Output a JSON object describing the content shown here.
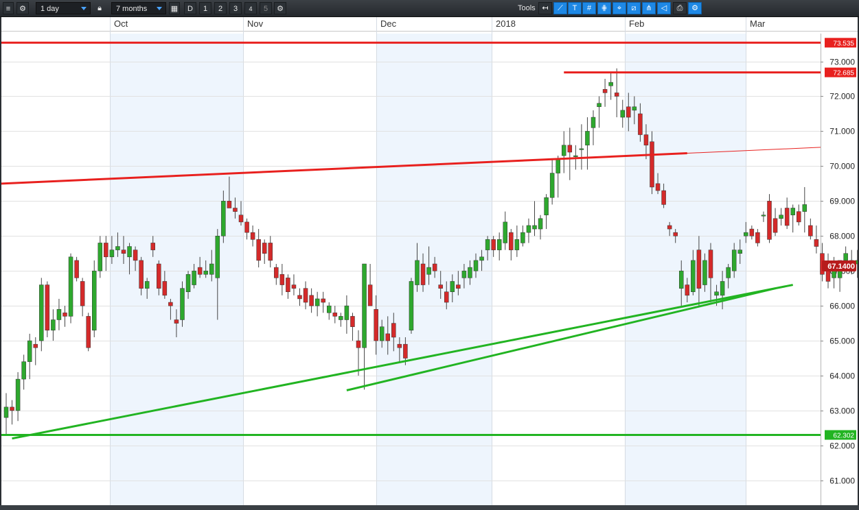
{
  "toolbar": {
    "interval": "1 day",
    "period": "7 months",
    "quick_d": "D",
    "quick_1": "1",
    "quick_2": "2",
    "quick_3": "3",
    "quick_4": "4",
    "quick_5": "5",
    "tools_label": "Tools"
  },
  "colors": {
    "up": "#2ea82e",
    "down": "#d42a2a",
    "trend_red": "#e8201e",
    "trend_green": "#22b422",
    "price_badge": "#b71c1c",
    "band": "#eef5fd"
  },
  "chart_data": {
    "type": "candlestick",
    "ylim": [
      60.8,
      73.6
    ],
    "y_ticks": [
      "73.000",
      "72.000",
      "71.000",
      "70.000",
      "69.000",
      "68.000",
      "67.000",
      "66.000",
      "65.000",
      "64.000",
      "63.000",
      "62.000",
      "61.000"
    ],
    "x_labels": [
      "Oct",
      "Nov",
      "Dec",
      "2018",
      "Feb",
      "Mar"
    ],
    "horizontal_levels": [
      {
        "value": 73.535,
        "label": "73.535",
        "color": "red"
      },
      {
        "value": 62.302,
        "label": "62.302",
        "color": "green"
      }
    ],
    "segment_levels": [
      {
        "value": 72.685,
        "label": "72.685",
        "color": "red",
        "from_index": 95
      }
    ],
    "last_price": {
      "value": 67.14,
      "label": "67.1400"
    },
    "trendlines": [
      {
        "color": "red",
        "points": [
          [
            0,
            69.5
          ],
          [
            116,
            70.37
          ]
        ],
        "extend_to": 134
      },
      {
        "color": "green",
        "points": [
          [
            1,
            62.2
          ],
          [
            134,
            66.6
          ]
        ]
      },
      {
        "color": "green",
        "points": [
          [
            58,
            63.58
          ],
          [
            131,
            66.5
          ]
        ]
      }
    ],
    "candles": [
      [
        62.8,
        63.5,
        62.3,
        63.1
      ],
      [
        63.1,
        63.3,
        62.6,
        63.0
      ],
      [
        63.0,
        64.1,
        62.7,
        63.9
      ],
      [
        63.9,
        64.6,
        63.6,
        64.4
      ],
      [
        64.4,
        65.2,
        63.9,
        65.0
      ],
      [
        64.9,
        65.1,
        64.3,
        64.8
      ],
      [
        65.0,
        66.8,
        64.7,
        66.6
      ],
      [
        66.6,
        66.7,
        65.1,
        65.3
      ],
      [
        65.3,
        65.9,
        65.0,
        65.6
      ],
      [
        65.6,
        66.2,
        65.3,
        65.9
      ],
      [
        65.8,
        66.0,
        65.4,
        65.7
      ],
      [
        65.7,
        67.5,
        65.5,
        67.4
      ],
      [
        67.3,
        67.4,
        66.7,
        66.8
      ],
      [
        66.7,
        66.8,
        65.7,
        66.0
      ],
      [
        65.7,
        65.8,
        64.7,
        64.8
      ],
      [
        65.3,
        67.3,
        65.1,
        67.0
      ],
      [
        67.0,
        68.0,
        66.8,
        67.8
      ],
      [
        67.8,
        68.0,
        67.0,
        67.4
      ],
      [
        67.4,
        68.0,
        67.2,
        67.6
      ],
      [
        67.6,
        68.1,
        67.4,
        67.7
      ],
      [
        67.6,
        68.0,
        67.2,
        67.5
      ],
      [
        67.4,
        67.8,
        66.9,
        67.7
      ],
      [
        67.6,
        67.7,
        67.0,
        67.3
      ],
      [
        67.3,
        67.4,
        66.3,
        66.5
      ],
      [
        66.5,
        66.8,
        66.2,
        66.7
      ],
      [
        67.8,
        68.0,
        67.4,
        67.6
      ],
      [
        67.2,
        67.3,
        66.3,
        66.5
      ],
      [
        66.7,
        67.0,
        66.2,
        66.3
      ],
      [
        66.1,
        66.2,
        65.6,
        66.0
      ],
      [
        65.6,
        65.9,
        65.1,
        65.5
      ],
      [
        65.6,
        66.7,
        65.4,
        66.5
      ],
      [
        66.4,
        67.0,
        66.2,
        66.9
      ],
      [
        66.6,
        67.2,
        66.5,
        67.0
      ],
      [
        67.1,
        67.4,
        66.8,
        66.9
      ],
      [
        66.9,
        67.3,
        66.8,
        67.0
      ],
      [
        66.9,
        67.6,
        66.7,
        67.2
      ],
      [
        66.8,
        68.2,
        65.6,
        68.0
      ],
      [
        68.0,
        69.3,
        67.8,
        69.0
      ],
      [
        69.0,
        69.7,
        68.9,
        68.8
      ],
      [
        68.8,
        69.1,
        68.5,
        68.7
      ],
      [
        68.6,
        69.0,
        68.3,
        68.4
      ],
      [
        68.4,
        68.5,
        67.9,
        68.1
      ],
      [
        68.1,
        68.3,
        67.7,
        67.9
      ],
      [
        67.9,
        68.2,
        67.1,
        67.3
      ],
      [
        67.8,
        67.9,
        67.2,
        67.5
      ],
      [
        67.8,
        68.0,
        67.1,
        67.3
      ],
      [
        67.1,
        67.2,
        66.6,
        66.8
      ],
      [
        66.9,
        67.2,
        66.3,
        66.6
      ],
      [
        66.8,
        66.9,
        66.2,
        66.4
      ],
      [
        66.6,
        66.9,
        66.3,
        66.5
      ],
      [
        66.3,
        66.5,
        66.0,
        66.2
      ],
      [
        66.5,
        66.7,
        65.9,
        66.1
      ],
      [
        66.3,
        66.5,
        65.8,
        66.0
      ],
      [
        66.0,
        66.4,
        65.7,
        66.2
      ],
      [
        66.2,
        66.4,
        65.8,
        66.1
      ],
      [
        65.8,
        66.1,
        65.6,
        66.0
      ],
      [
        65.8,
        66.0,
        65.5,
        65.7
      ],
      [
        65.6,
        65.8,
        65.4,
        65.7
      ],
      [
        65.6,
        66.3,
        65.2,
        66.0
      ],
      [
        65.7,
        65.8,
        65.0,
        65.4
      ],
      [
        65.0,
        65.3,
        64.0,
        64.8
      ],
      [
        64.8,
        66.9,
        63.6,
        67.2
      ],
      [
        66.6,
        67.2,
        66.0,
        66.0
      ],
      [
        65.9,
        66.3,
        64.6,
        65.0
      ],
      [
        65.0,
        65.6,
        64.8,
        65.4
      ],
      [
        65.2,
        65.7,
        64.6,
        65.0
      ],
      [
        65.5,
        65.8,
        64.7,
        65.1
      ],
      [
        64.9,
        65.1,
        64.4,
        64.8
      ],
      [
        64.9,
        65.1,
        64.3,
        64.5
      ],
      [
        65.3,
        66.8,
        65.2,
        66.7
      ],
      [
        66.6,
        67.8,
        66.4,
        67.3
      ],
      [
        67.2,
        67.5,
        66.4,
        66.6
      ],
      [
        66.9,
        67.7,
        66.6,
        67.1
      ],
      [
        67.2,
        67.4,
        66.8,
        67.0
      ],
      [
        66.6,
        67.0,
        66.2,
        66.5
      ],
      [
        66.4,
        66.7,
        65.9,
        66.1
      ],
      [
        66.4,
        66.9,
        66.1,
        66.7
      ],
      [
        66.6,
        67.0,
        66.3,
        66.5
      ],
      [
        66.8,
        67.2,
        66.5,
        67.0
      ],
      [
        66.8,
        67.3,
        66.6,
        67.1
      ],
      [
        67.0,
        67.5,
        66.8,
        67.3
      ],
      [
        67.3,
        67.6,
        67.0,
        67.4
      ],
      [
        67.6,
        68.0,
        67.3,
        67.9
      ],
      [
        67.9,
        68.0,
        67.4,
        67.6
      ],
      [
        67.6,
        68.1,
        67.3,
        67.9
      ],
      [
        67.8,
        68.7,
        67.6,
        68.4
      ],
      [
        68.1,
        68.2,
        67.3,
        67.6
      ],
      [
        67.6,
        68.3,
        67.4,
        67.9
      ],
      [
        67.8,
        68.3,
        67.7,
        68.1
      ],
      [
        68.1,
        68.5,
        67.8,
        68.3
      ],
      [
        68.2,
        69.0,
        68.0,
        68.3
      ],
      [
        68.2,
        68.6,
        67.9,
        68.5
      ],
      [
        68.6,
        69.2,
        68.2,
        69.1
      ],
      [
        69.1,
        70.2,
        68.9,
        69.8
      ],
      [
        69.8,
        70.3,
        69.1,
        70.2
      ],
      [
        70.3,
        71.0,
        69.8,
        70.6
      ],
      [
        70.6,
        71.1,
        69.6,
        70.4
      ],
      [
        70.3,
        70.6,
        69.9,
        70.3
      ],
      [
        70.5,
        71.2,
        69.9,
        70.5
      ],
      [
        70.6,
        71.4,
        69.9,
        71.0
      ],
      [
        71.1,
        71.6,
        70.6,
        71.4
      ],
      [
        71.7,
        72.0,
        71.1,
        71.8
      ],
      [
        72.2,
        72.5,
        71.7,
        72.1
      ],
      [
        72.3,
        72.7,
        71.9,
        72.4
      ],
      [
        72.1,
        72.8,
        71.4,
        72.0
      ],
      [
        71.4,
        71.9,
        71.1,
        71.6
      ],
      [
        71.7,
        72.1,
        71.0,
        71.4
      ],
      [
        71.6,
        72.0,
        71.2,
        71.7
      ],
      [
        71.5,
        71.8,
        70.7,
        70.9
      ],
      [
        70.9,
        71.2,
        70.2,
        70.6
      ],
      [
        70.7,
        71.0,
        69.2,
        69.4
      ],
      [
        69.5,
        69.8,
        69.2,
        69.3
      ],
      [
        69.3,
        69.5,
        68.8,
        68.9
      ],
      [
        68.3,
        68.4,
        68.0,
        68.2
      ],
      [
        68.1,
        68.2,
        67.8,
        68.0
      ],
      [
        66.5,
        67.3,
        66.0,
        67.0
      ],
      [
        66.6,
        66.8,
        66.1,
        66.3
      ],
      [
        66.4,
        67.6,
        66.3,
        67.3
      ],
      [
        67.6,
        68.0,
        66.0,
        66.5
      ],
      [
        66.6,
        67.5,
        66.4,
        67.3
      ],
      [
        67.6,
        67.8,
        66.1,
        66.8
      ],
      [
        66.3,
        66.6,
        66.0,
        66.4
      ],
      [
        66.3,
        67.0,
        65.9,
        66.7
      ],
      [
        66.8,
        67.2,
        66.5,
        67.1
      ],
      [
        67.0,
        67.8,
        66.8,
        67.6
      ],
      [
        67.5,
        67.9,
        67.2,
        67.6
      ],
      [
        68.0,
        68.4,
        67.8,
        68.1
      ],
      [
        68.2,
        68.3,
        67.9,
        68.0
      ],
      [
        68.1,
        68.2,
        67.7,
        67.8
      ],
      [
        68.6,
        68.7,
        68.4,
        68.6
      ],
      [
        69.0,
        69.2,
        67.8,
        67.9
      ],
      [
        68.5,
        68.8,
        68.0,
        68.1
      ],
      [
        68.5,
        68.8,
        68.3,
        68.6
      ],
      [
        68.8,
        69.1,
        68.2,
        68.3
      ],
      [
        68.6,
        68.9,
        68.1,
        68.8
      ],
      [
        68.7,
        68.9,
        68.3,
        68.4
      ],
      [
        68.7,
        69.4,
        68.1,
        68.9
      ],
      [
        68.3,
        68.5,
        67.9,
        68.0
      ],
      [
        67.9,
        68.3,
        67.5,
        67.7
      ],
      [
        67.5,
        67.8,
        66.7,
        66.9
      ],
      [
        67.1,
        67.5,
        66.5,
        66.7
      ],
      [
        66.8,
        67.4,
        66.5,
        67.0
      ],
      [
        66.8,
        67.3,
        66.4,
        67.3
      ],
      [
        67.3,
        67.7,
        67.0,
        67.5
      ],
      [
        67.3,
        67.6,
        66.9,
        67.2
      ],
      [
        67.2,
        67.6,
        66.8,
        67.3
      ],
      [
        67.2,
        67.3,
        66.7,
        67.0
      ],
      [
        66.9,
        67.2,
        66.5,
        66.8
      ],
      [
        66.6,
        66.8,
        66.4,
        66.5
      ],
      [
        66.9,
        67.2,
        66.7,
        67.0
      ],
      [
        67.1,
        67.3,
        66.8,
        67.1
      ]
    ]
  }
}
